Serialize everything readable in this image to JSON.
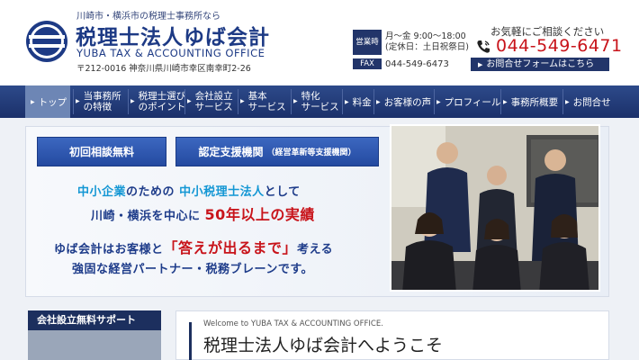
{
  "header": {
    "tagline": "川崎市・横浜市の税理士事務所なら",
    "office_name": "税理士法人ゆば会計",
    "office_name_en": "YUBA TAX & ACCOUNTING OFFICE",
    "address": "〒212-0016 神奈川県川崎市幸区南幸町2-26",
    "hours_badge": "営業時間",
    "hours_line1": "月〜金 9:00〜18:00",
    "hours_line2": "(定休日：土日祝祭日)",
    "fax_badge": "FAX",
    "fax_number": "044-549-6473",
    "consult_label": "お気軽にご相談ください",
    "phone_number": "044-549-6471",
    "contact_button": "お問合せフォームはこちら"
  },
  "nav": {
    "items": [
      {
        "label": "トップ"
      },
      {
        "label1": "当事務所",
        "label2": "の特徴"
      },
      {
        "label1": "税理士選び",
        "label2": "のポイント"
      },
      {
        "label1": "会社設立",
        "label2": "サービス"
      },
      {
        "label1": "基本",
        "label2": "サービス"
      },
      {
        "label1": "特化",
        "label2": "サービス"
      },
      {
        "label": "料金"
      },
      {
        "label": "お客様の声"
      },
      {
        "label": "プロフィール"
      },
      {
        "label": "事務所概要"
      },
      {
        "label": "お問合せ"
      }
    ]
  },
  "hero": {
    "btn_first": "初回相談無料",
    "btn_support": "認定支援機関",
    "btn_support_sub": "（経営革新等支援機関）",
    "line1_a": "中小企業",
    "line1_b": "のための",
    "line1_c": "中小税理士法人",
    "line1_d": "として",
    "line2_a": "川崎・横浜を中心に",
    "line2_b": "50年以上の実績",
    "line3_a": "ゆば会計はお客様と",
    "line3_b": "「答えが出るまで」",
    "line3_c": "考える",
    "line4": "強固な経営パートナー・税務ブレーンです。"
  },
  "sidebar": {
    "title": "会社設立無料サポート"
  },
  "welcome": {
    "en": "Welcome to YUBA TAX & ACCOUNTING OFFICE.",
    "title": "税理士法人ゆば会計へようこそ"
  },
  "colors": {
    "navy": "#1d3a85",
    "nav_bg": "#22356a",
    "accent_red": "#c8141b",
    "accent_cyan": "#1497d4"
  },
  "icons": [
    "logo-icon",
    "phone-icon",
    "arrow-icon"
  ]
}
